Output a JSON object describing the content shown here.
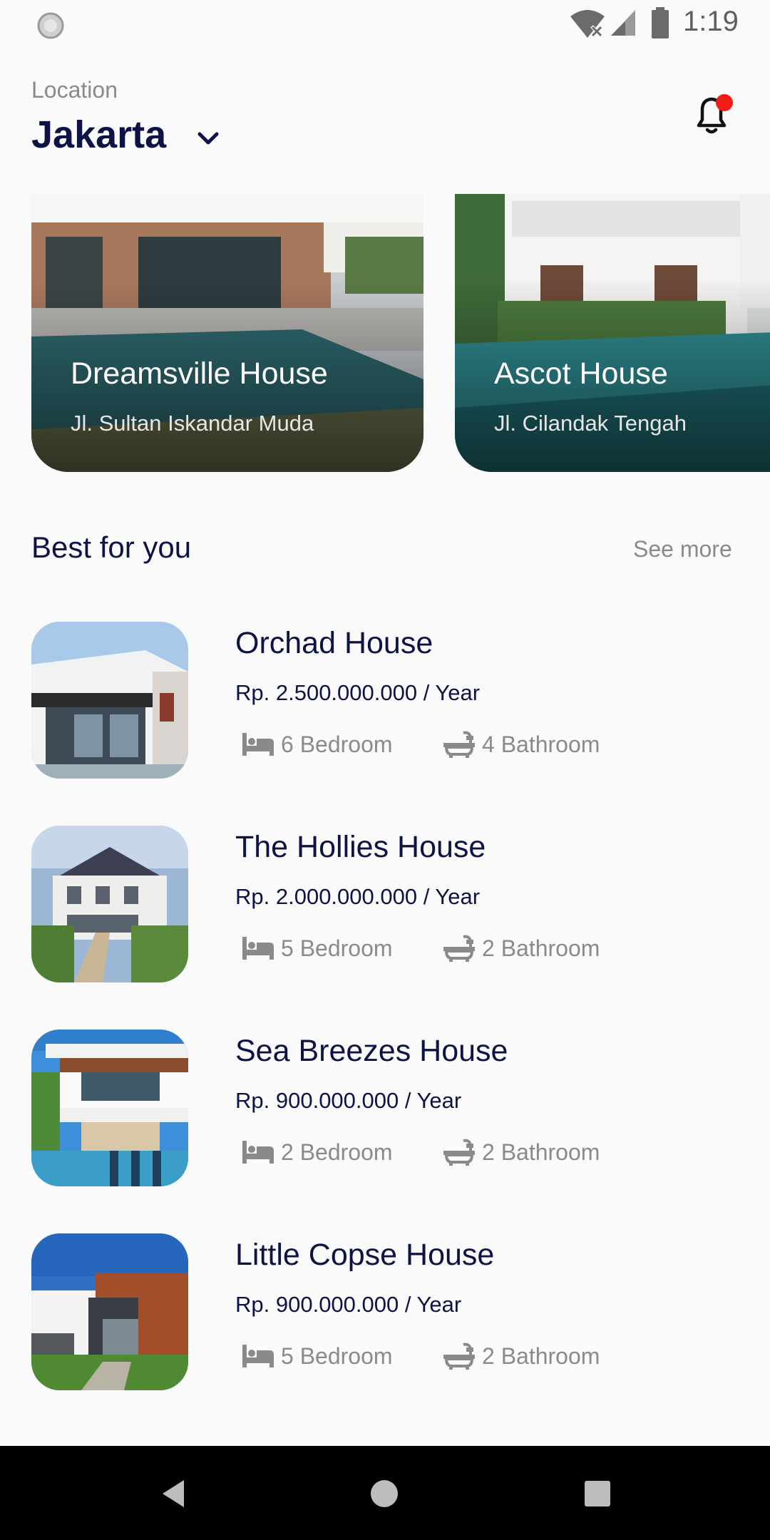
{
  "status_bar": {
    "time": "1:19",
    "icons": [
      "loading-icon",
      "wifi-icon",
      "signal-icon",
      "battery-icon"
    ]
  },
  "header": {
    "location_label": "Location",
    "location_value": "Jakarta",
    "notification_badge_color": "#f21c16"
  },
  "featured": [
    {
      "name": "Dreamsville House",
      "address": "Jl. Sultan Iskandar Muda"
    },
    {
      "name": "Ascot House",
      "address": "Jl. Cilandak Tengah"
    }
  ],
  "section": {
    "title": "Best for you",
    "see_more": "See more"
  },
  "houses": [
    {
      "name": "Orchad House",
      "price": "Rp. 2.500.000.000 / Year",
      "bedrooms": "6 Bedroom",
      "bathrooms": "4 Bathroom"
    },
    {
      "name": "The Hollies House",
      "price": "Rp. 2.000.000.000 / Year",
      "bedrooms": "5 Bedroom",
      "bathrooms": "2 Bathroom"
    },
    {
      "name": "Sea Breezes House",
      "price": "Rp. 900.000.000 / Year",
      "bedrooms": "2 Bedroom",
      "bathrooms": "2 Bathroom"
    },
    {
      "name": "Little Copse House",
      "price": "Rp. 900.000.000 / Year",
      "bedrooms": "5 Bedroom",
      "bathrooms": "2 Bathroom"
    }
  ],
  "colors": {
    "primary_text": "#0d1445",
    "secondary_text": "#8a8a8a",
    "background": "#fafafa"
  }
}
